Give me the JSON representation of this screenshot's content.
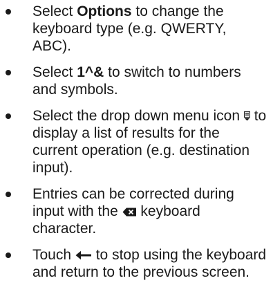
{
  "items": [
    {
      "pre": "Select ",
      "bold": "Options",
      "post": " to change the keyboard type (e.g. QWERTY, ABC)."
    },
    {
      "pre": "Select ",
      "bold": "1^&",
      "post": " to switch to numbers and symbols."
    },
    {
      "pre": "Select the drop down menu icon",
      "icon": "dropdown-menu-icon",
      "post": " to display a list of results for the current operation (e.g. destination input)."
    },
    {
      "pre": "Entries can be corrected during input with the",
      "icon": "backspace-icon",
      "post": " keyboard character."
    },
    {
      "pre": "Touch",
      "icon": "back-arrow-icon",
      "post": " to stop using the keyboard and return to the previous screen."
    }
  ]
}
